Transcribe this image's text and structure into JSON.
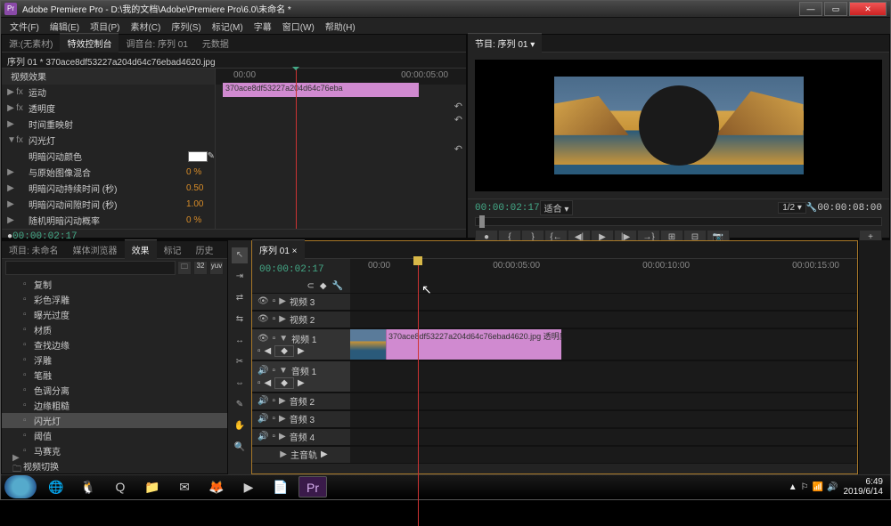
{
  "app": {
    "title": "Adobe Premiere Pro - D:\\我的文档\\Adobe\\Premiere Pro\\6.0\\未命名 *",
    "icon_name": "Pr"
  },
  "menu": [
    "文件(F)",
    "编辑(E)",
    "项目(P)",
    "素材(C)",
    "序列(S)",
    "标记(M)",
    "字幕",
    "窗口(W)",
    "帮助(H)"
  ],
  "source_tabs": [
    "源:(无素材)",
    "特效控制台",
    "调音台: 序列 01",
    "元数据"
  ],
  "source_active_tab": 1,
  "effect_controls": {
    "clip_title": "序列 01 * 370ace8df53227a204d64c76ebad4620.jpg",
    "header": "视频效果",
    "clip_bar_label": "370ace8df53227a204d64c76eba",
    "ruler": [
      "00:00",
      "00:00:05:00"
    ],
    "rows": [
      {
        "tri": "▶",
        "fx": "fx",
        "label": "运动",
        "val": ""
      },
      {
        "tri": "▶",
        "fx": "fx",
        "label": "透明度",
        "val": ""
      },
      {
        "tri": "▶",
        "fx": "",
        "label": "时间重映射",
        "val": ""
      },
      {
        "tri": "▼",
        "fx": "fx",
        "label": "闪光灯",
        "val": ""
      },
      {
        "tri": "",
        "fx": "",
        "label": "  明暗闪动颜色",
        "val": "",
        "swatch": true
      },
      {
        "tri": "▶",
        "fx": "",
        "label": "  与原始图像混合",
        "val": "0 %"
      },
      {
        "tri": "▶",
        "fx": "",
        "label": "  明暗闪动持续时间 (秒)",
        "val": "0.50"
      },
      {
        "tri": "▶",
        "fx": "",
        "label": "  明暗闪动间隙时间 (秒)",
        "val": "1.00"
      },
      {
        "tri": "▶",
        "fx": "",
        "label": "  随机明暗闪动概率",
        "val": "0 %"
      }
    ],
    "timecode": "00:00:02:17"
  },
  "program": {
    "tab": "节目: 序列 01",
    "timecode": "00:00:02:17",
    "zoom": "适合",
    "ratio": "1/2",
    "duration": "00:00:08:00"
  },
  "project_tabs": [
    "项目: 未命名",
    "媒体浏览器",
    "效果",
    "标记",
    "历史"
  ],
  "project_active_tab": 2,
  "search_placeholder": "",
  "effects_list": [
    "复制",
    "彩色浮雕",
    "曝光过度",
    "材质",
    "查找边缘",
    "浮雕",
    "笔融",
    "色调分离",
    "边缘粗糙"
  ],
  "effects_selected": "闪光灯",
  "effects_after": [
    "阈值",
    "马赛克"
  ],
  "effects_folder": "视频切换",
  "tools": [
    {
      "name": "selection",
      "glyph": "↖",
      "active": true
    },
    {
      "name": "track-select",
      "glyph": "⇥"
    },
    {
      "name": "ripple",
      "glyph": "⇄"
    },
    {
      "name": "rolling",
      "glyph": "⇆"
    },
    {
      "name": "rate",
      "glyph": "↔"
    },
    {
      "name": "razor",
      "glyph": "✂"
    },
    {
      "name": "slip",
      "glyph": "⇔"
    },
    {
      "name": "pen",
      "glyph": "✎"
    },
    {
      "name": "hand",
      "glyph": "✋"
    },
    {
      "name": "zoom",
      "glyph": "🔍"
    }
  ],
  "timeline": {
    "tab": "序列 01",
    "timecode": "00:00:02:17",
    "ruler": [
      "00:00",
      "00:00:05:00",
      "00:00:10:00",
      "00:00:15:00"
    ],
    "tracks_video": [
      "视频 3",
      "视频 2",
      "视频 1"
    ],
    "tracks_audio": [
      "音频 1",
      "音频 2",
      "音频 3",
      "音频 4"
    ],
    "master": "主音轨",
    "clip_name": "370ace8df53227a204d64c76ebad4620.jpg",
    "clip_fx": "透明度:透明度 ▾"
  },
  "transport_icons": [
    "●",
    "{",
    "}",
    "{←",
    "◀|",
    "▶",
    "|▶",
    "→}",
    "⊞",
    "⊟",
    "📷"
  ],
  "taskbar": {
    "apps": [
      "🌐",
      "🐧",
      "Q",
      "📁",
      "✉",
      "🦊",
      "▶",
      "📄"
    ],
    "prem": "Pr",
    "tray_icons": [
      "▲",
      "⚐",
      "📶",
      "🔊"
    ],
    "time": "6:49",
    "date": "2019/6/14"
  }
}
